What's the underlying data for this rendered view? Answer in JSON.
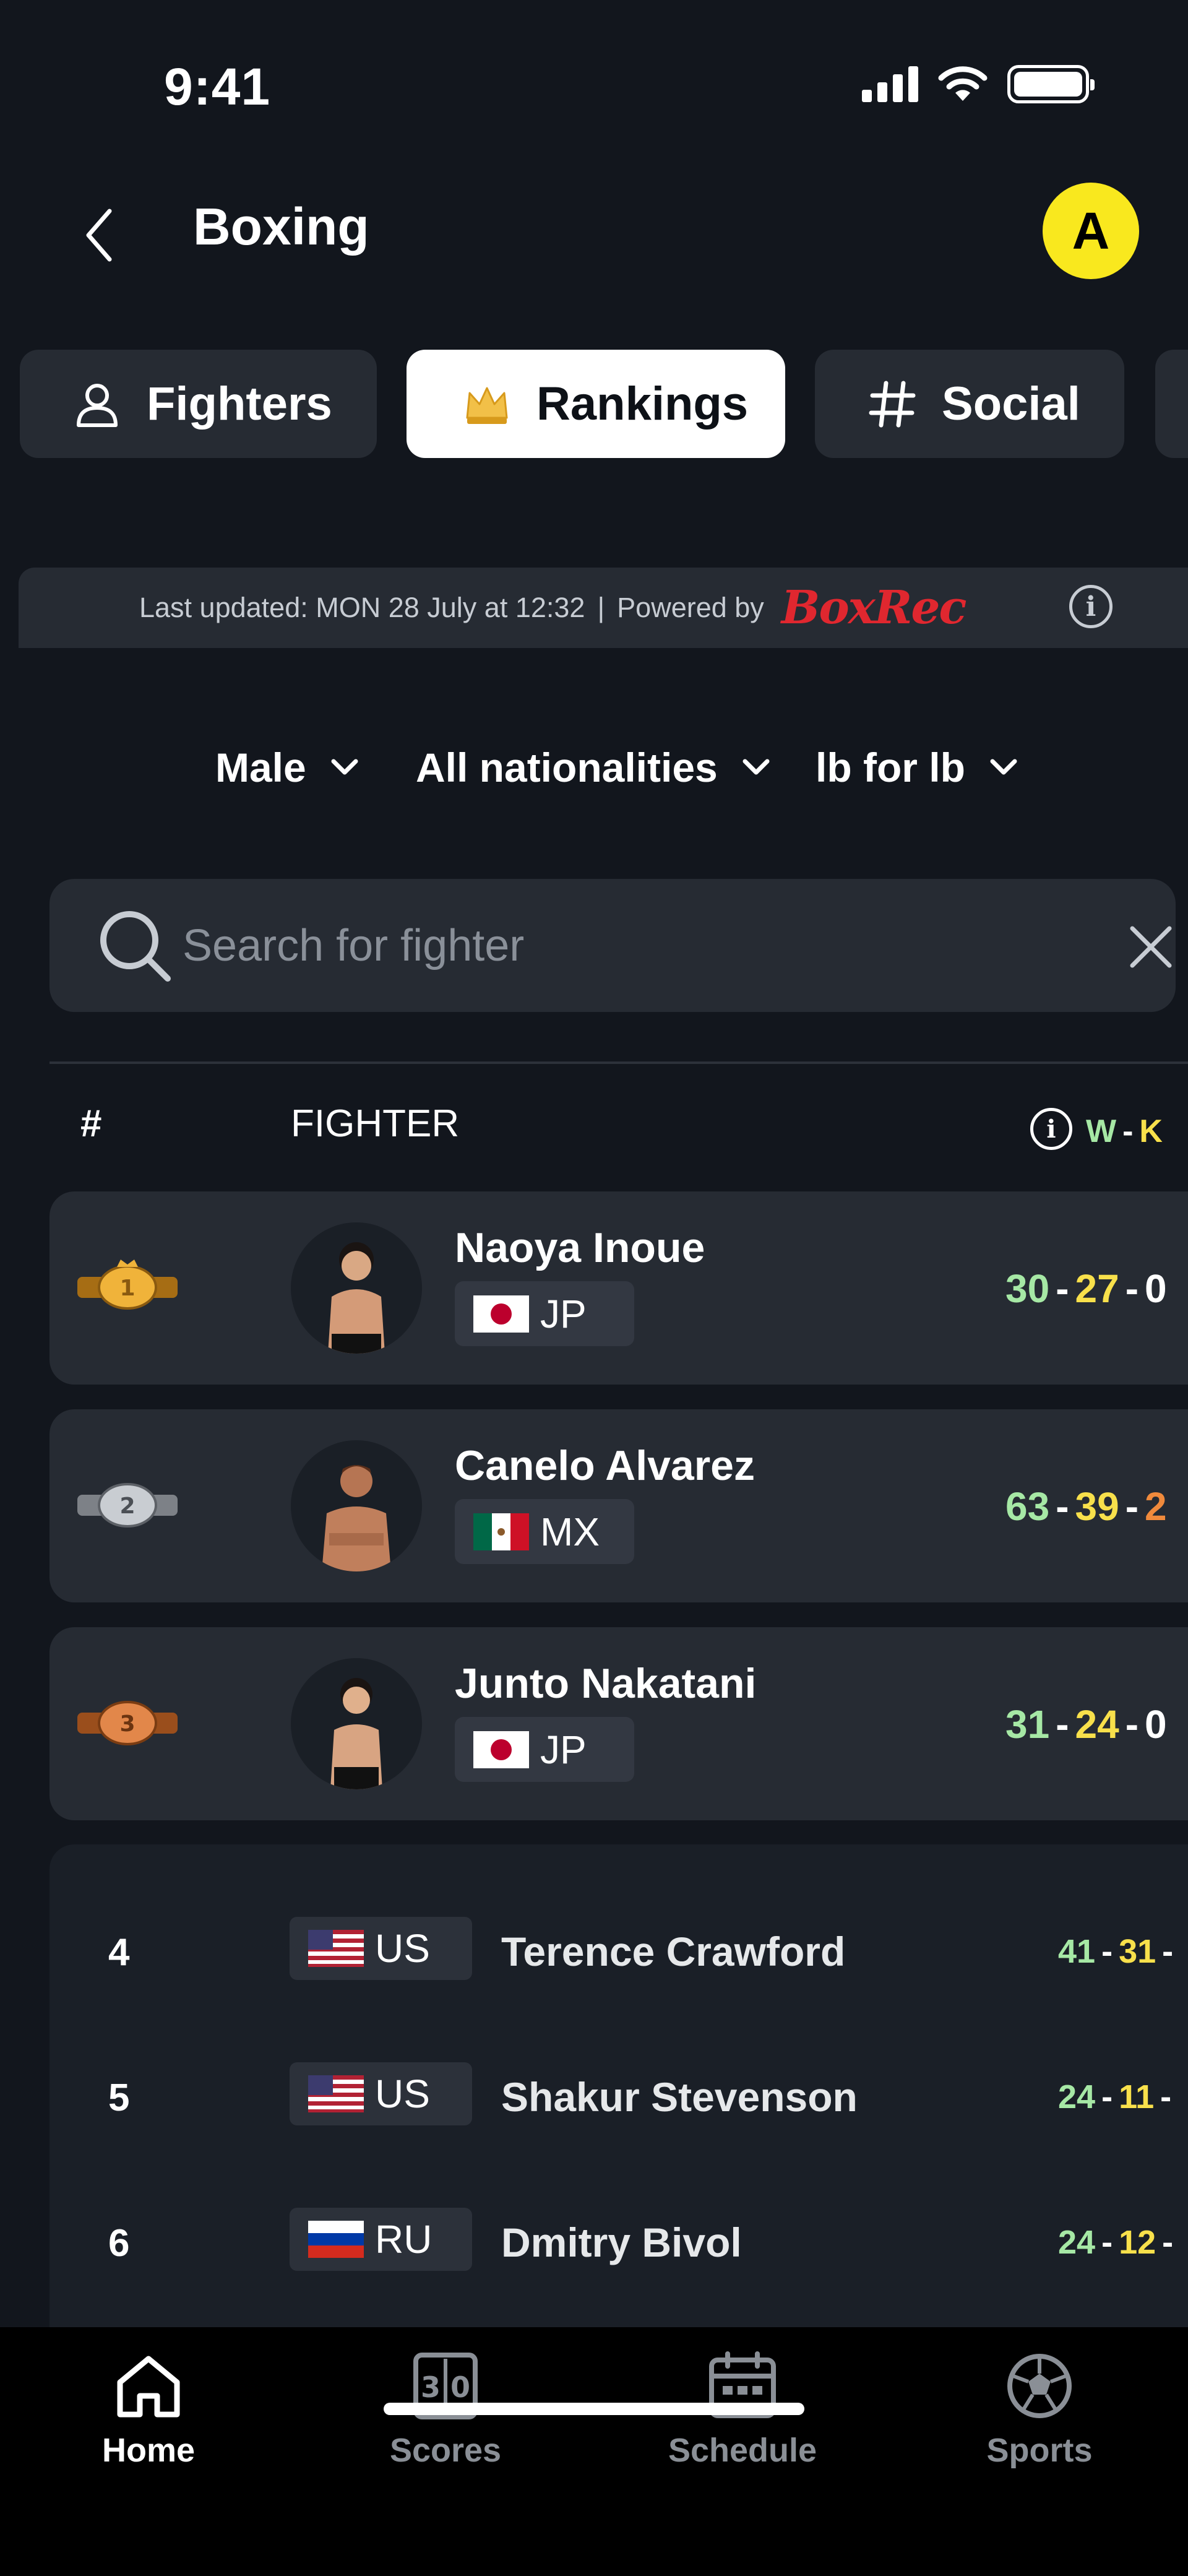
{
  "status_bar": {
    "time": "9:41"
  },
  "header": {
    "title": "Boxing",
    "avatar_initial": "A"
  },
  "tabs": [
    {
      "label": "Fighters",
      "icon": "person-icon",
      "active": false
    },
    {
      "label": "Rankings",
      "icon": "crown-icon",
      "active": true
    },
    {
      "label": "Social",
      "icon": "hashtag-icon",
      "active": false
    }
  ],
  "update_bar": {
    "last_updated": "Last updated: MON 28 July at 12:32",
    "separator": "|",
    "powered_by": "Powered by",
    "provider": "BoxRec"
  },
  "filters": [
    {
      "label": "Male"
    },
    {
      "label": "All nationalities"
    },
    {
      "label": "lb for lb"
    }
  ],
  "search": {
    "placeholder": "Search for fighter",
    "value": ""
  },
  "table_header": {
    "rank": "#",
    "fighter": "FIGHTER",
    "record_w": "W",
    "record_k": "K",
    "dash": "-"
  },
  "top_fighters": [
    {
      "rank": "1",
      "belt": "gold",
      "name": "Naoya Inoue",
      "country": "JP",
      "wins": "30",
      "ko": "27",
      "third": "0"
    },
    {
      "rank": "2",
      "belt": "silver",
      "name": "Canelo Alvarez",
      "country": "MX",
      "wins": "63",
      "ko": "39",
      "third": "2"
    },
    {
      "rank": "3",
      "belt": "bronze",
      "name": "Junto Nakatani",
      "country": "JP",
      "wins": "31",
      "ko": "24",
      "third": "0"
    }
  ],
  "list_fighters": [
    {
      "rank": "4",
      "country": "US",
      "name": "Terence Crawford",
      "wins": "41",
      "ko": "31"
    },
    {
      "rank": "5",
      "country": "US",
      "name": "Shakur Stevenson",
      "wins": "24",
      "ko": "11"
    },
    {
      "rank": "6",
      "country": "RU",
      "name": "Dmitry Bivol",
      "wins": "24",
      "ko": "12"
    }
  ],
  "bottom_nav": [
    {
      "label": "Home",
      "icon": "home-icon",
      "active": true
    },
    {
      "label": "Scores",
      "icon": "scoreboard-icon",
      "active": false
    },
    {
      "label": "Schedule",
      "icon": "calendar-icon",
      "active": false
    },
    {
      "label": "Sports",
      "icon": "soccer-ball-icon",
      "active": false
    }
  ],
  "colors": {
    "background": "#12161d",
    "card": "#262b33",
    "accent_yellow": "#f9e81e",
    "wins_green": "#a6e8a5",
    "ko_yellow": "#f8e04b",
    "boxrec_red": "#e0272f"
  }
}
